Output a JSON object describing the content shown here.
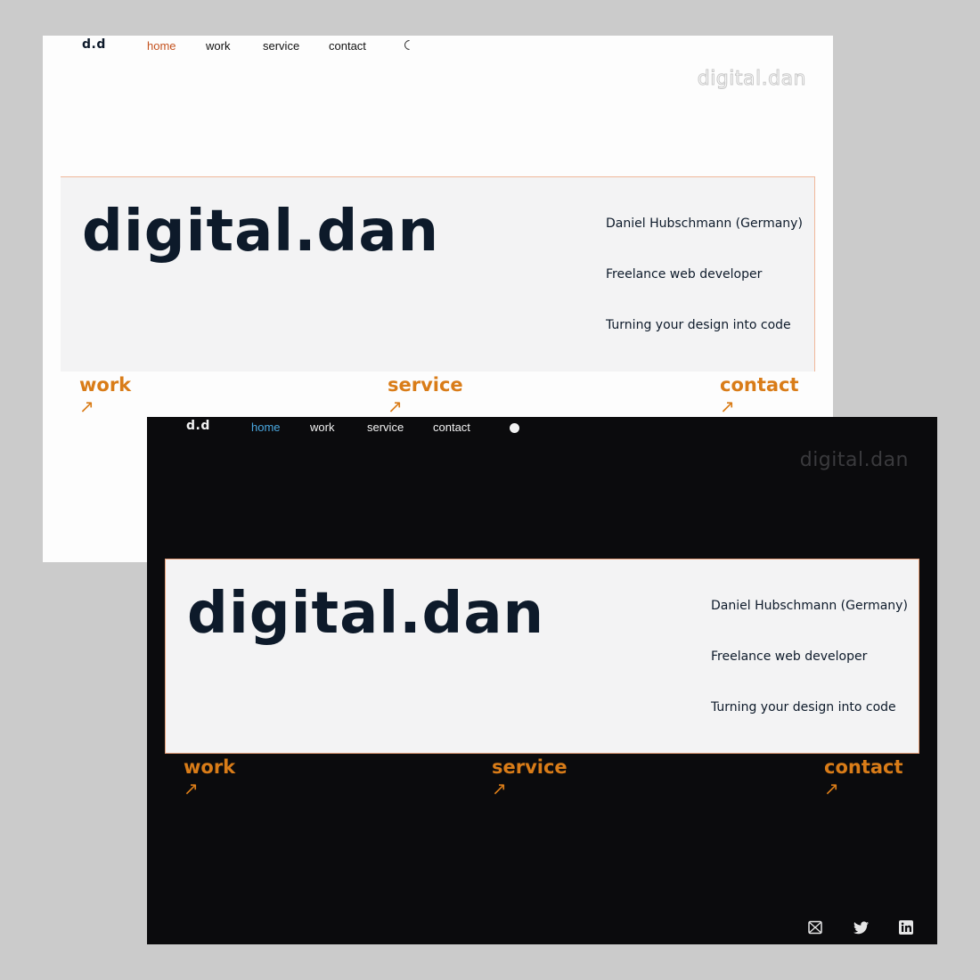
{
  "light": {
    "logo": "d.d",
    "nav": [
      "home",
      "work",
      "service",
      "contact"
    ],
    "active_nav": "home",
    "theme_toggle_icon": "moon-icon",
    "brand_outline": "digital.dan",
    "hero": {
      "title": "digital.dan",
      "lines": [
        "Daniel Hubschmann (Germany)",
        "Freelance web developer",
        "Turning your design into code"
      ]
    },
    "links": [
      {
        "label": "work",
        "arrow": "↗"
      },
      {
        "label": "service",
        "arrow": "↗"
      },
      {
        "label": "contact",
        "arrow": "↗"
      }
    ]
  },
  "dark": {
    "logo": "d.d",
    "nav": [
      "home",
      "work",
      "service",
      "contact"
    ],
    "active_nav": "home",
    "theme_toggle_icon": "sun-icon",
    "brand_outline": "digital.dan",
    "hero": {
      "title": "digital.dan",
      "lines": [
        "Daniel Hubschmann (Germany)",
        "Freelance web developer",
        "Turning your design into code"
      ]
    },
    "links": [
      {
        "label": "work",
        "arrow": "↗"
      },
      {
        "label": "service",
        "arrow": "↗"
      },
      {
        "label": "contact",
        "arrow": "↗"
      }
    ],
    "social": [
      "mail-icon",
      "twitter-icon",
      "linkedin-icon"
    ]
  },
  "colors": {
    "accent_orange": "#d97c18",
    "active_light": "#c4521f",
    "active_dark": "#4aa8e0",
    "ink": "#0d1a2a",
    "dark_bg": "#0b0b0d"
  }
}
